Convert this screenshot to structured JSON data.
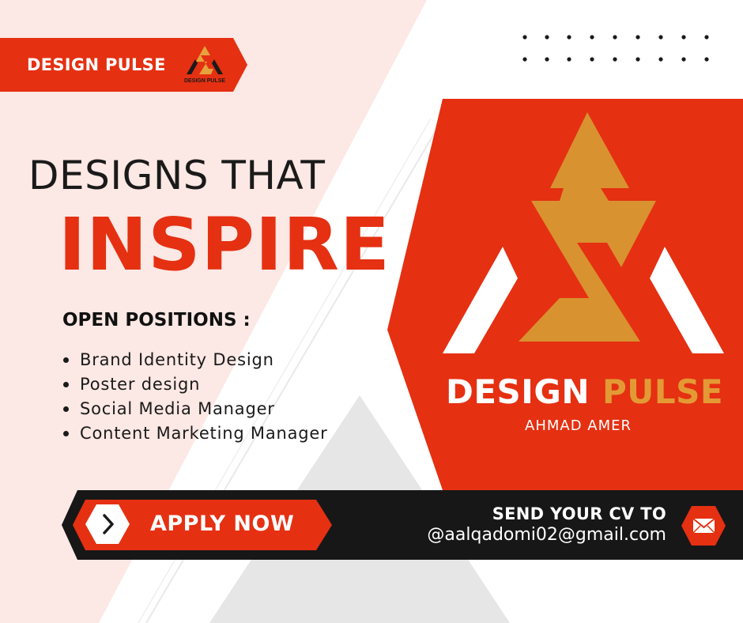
{
  "colors": {
    "accent_red": "#e53012",
    "logo_orange": "#d8922f",
    "dark": "#171717",
    "pale_pink": "#fce8e4",
    "grey_shape": "#e6e6e6"
  },
  "header": {
    "label": "DESIGN PULSE",
    "logo_icon": "design-pulse-logo-icon",
    "logo_caption": "DESIGN PULSE"
  },
  "hero": {
    "line1": "DESIGNS THAT",
    "line2": "INSPIRE"
  },
  "positions": {
    "title": "OPEN POSITIONS :",
    "items": [
      "Brand Identity Design",
      "Poster design",
      "Social Media Manager",
      "Content Marketing Manager"
    ]
  },
  "brand": {
    "name_part1": "DESIGN",
    "name_part2": "PULSE",
    "subtitle": "AHMAD AMER"
  },
  "cta": {
    "apply_label": "APPLY NOW",
    "apply_icon": "chevron-right-icon",
    "send_title": "SEND YOUR CV TO",
    "email": "@aalqadomi02@gmail.com",
    "mail_icon": "envelope-icon"
  }
}
